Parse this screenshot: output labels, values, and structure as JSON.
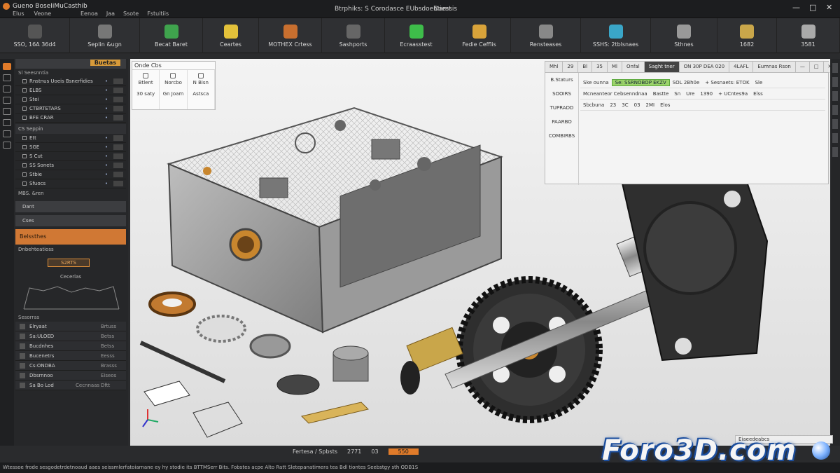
{
  "titlebar": {
    "app_name": "Gueno BoseIiMuCasthib",
    "menu_left": [
      "Elus",
      "Veone"
    ],
    "menu_right": [
      "Eenoa",
      "Jaa",
      "Ssote",
      "Fstuitiis"
    ],
    "window_title": "Btrphiks: S Corodasce EUbsdoehtiest",
    "window_title2": "Damsis",
    "controls": [
      "—",
      "□",
      "✕"
    ]
  },
  "ribbon": [
    {
      "label": "SSO, 16A 36d4",
      "icon": "gear-icon",
      "color": "#555"
    },
    {
      "label": "Seplin &ugn",
      "icon": "sketch-icon",
      "color": "#777"
    },
    {
      "label": "Becat Baret",
      "icon": "palette-icon",
      "color": "#3fa34d"
    },
    {
      "label": "Ceartes",
      "icon": "person-icon",
      "color": "#e3c13a"
    },
    {
      "label": "MOTHEX Crtess",
      "icon": "book-icon",
      "color": "#c86f2f"
    },
    {
      "label": "Sashports",
      "icon": "grid-icon",
      "color": "#666"
    },
    {
      "label": "Ecraasstest",
      "icon": "circle-icon",
      "color": "#3ebd4a"
    },
    {
      "label": "Fedie Cefflis",
      "icon": "lens-icon",
      "color": "#d9a33a"
    },
    {
      "label": "Rensteases",
      "icon": "ring-icon",
      "color": "#888"
    },
    {
      "label": "SSHS: 2tblsnaes",
      "icon": "shape-icon",
      "color": "#3aa6c8"
    },
    {
      "label": "Sthnes",
      "icon": "wave-icon",
      "color": "#999"
    },
    {
      "label": "1682",
      "icon": "stack-icon",
      "color": "#c9a64a"
    },
    {
      "label": "3581",
      "icon": "wheel-icon",
      "color": "#aaa"
    }
  ],
  "left_panel": {
    "header_tag": "Buetas",
    "section1": "Sl Seesnntia",
    "items1": [
      "Rnstnus Uoeis Bsnerfidies",
      "ELBS",
      "Stei",
      "CTBRTETARS",
      "BFE CRAR"
    ],
    "group2": "CS Seppin",
    "items2": [
      "Ett",
      "SGE",
      "S Cut",
      "SS Sonets",
      "Stbie",
      "Sfuocs"
    ],
    "field_mbs": "MBS. &ren",
    "item_d": "Dant",
    "item_c": "Cses",
    "orange_bar": "Belssthes",
    "field_dis": "Dnbehteatioss",
    "orange_box": "S2RTS",
    "sketch_label": "Cecerlas",
    "list_header": "Sesorras",
    "list": [
      {
        "t": "Elryaat",
        "n": "Brtuss"
      },
      {
        "t": "Sa:ULOED",
        "n": "Betss"
      },
      {
        "t": "Bucdnhes",
        "n": "Betss"
      },
      {
        "t": "Bucenetrs",
        "n": "Eesss"
      },
      {
        "t": "Cs:ONDBA",
        "n": "Brasss"
      },
      {
        "t": "Dbsrnnoo",
        "n": "Eiseos"
      }
    ],
    "footer": "Sa Bo Lod",
    "footer2": "Cecnnaas",
    "footer3": "Dftt"
  },
  "viewport": {
    "left_panel_title": "Onde Cbs",
    "left_cells": [
      {
        "top": "",
        "mid": "Btlent",
        "bot": "30 saty"
      },
      {
        "top": "",
        "mid": "Norcbo",
        "bot": "Gn Joam"
      },
      {
        "top": "",
        "mid": "N Bisn",
        "bot": "Astsca"
      }
    ],
    "right_tabs": [
      "Mhl",
      "29",
      "Bl",
      "35",
      "Ml",
      "Onfal",
      "Saght tner",
      "ON 30P DEA 020",
      "4LAFL",
      "Eumnas Rson",
      "—",
      "□",
      "✕"
    ],
    "right_side": [
      "B.Staturs",
      "SOOIRS",
      "TUPRADD",
      "PAARBO",
      "COMBIRBS"
    ],
    "grid_rows": [
      [
        "Ske ounna",
        "Se: SSRNOBOP EKZV",
        "SOL 2Bh0e",
        "+ Sesnaets: ETOK",
        "Sle"
      ],
      [
        "Mcneanteor Cebsenndnaa",
        "Bastte",
        "Sn",
        "Ure",
        "1390",
        "+ UCntes9a",
        "Elss"
      ],
      [
        "Sbcbuna",
        "23",
        "3C",
        "03",
        "2MI",
        "Elos"
      ]
    ],
    "status": [
      "Fertesa / Spbsts",
      "2771",
      "03",
      "550"
    ],
    "bottom_right": "Eiaeedeabcs"
  },
  "statusbar": "Wtessoe frode sesgodetrdetnoaud aaes seissmlerfatoiarnane ey hy stodie its BTTMSerr Bits. Fobstes acpe Alto Ratt Sletepanatimera tea Bdl tiontes Seebstgy sth ODB1S",
  "watermark": "Foro3D.com"
}
